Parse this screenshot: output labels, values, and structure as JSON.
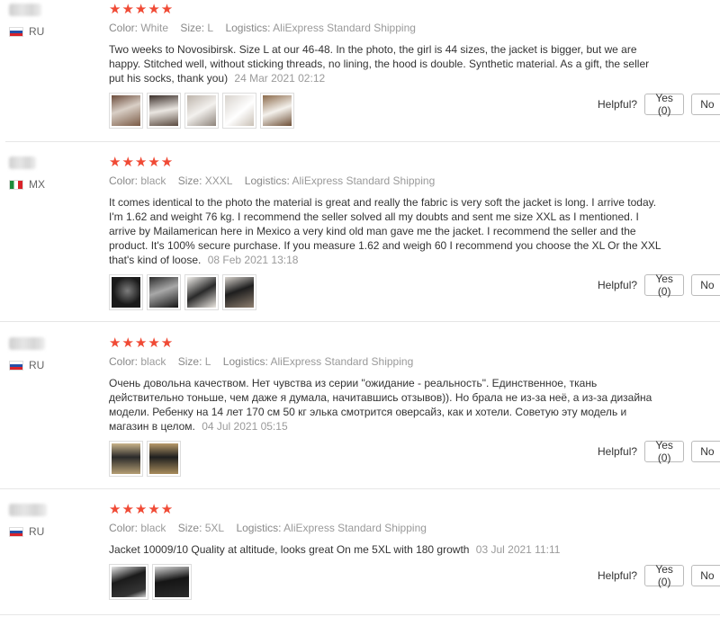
{
  "labels": {
    "color": "Color:",
    "size": "Size:",
    "logistics": "Logistics:",
    "helpful": "Helpful?",
    "stars": "★★★★★",
    "no": "No"
  },
  "colors": {
    "star": "#f04a35",
    "meta": "#9a9a9a",
    "divider": "#e6e6e6"
  },
  "reviews": [
    {
      "country": "RU",
      "flag": "ru",
      "rating": 5,
      "color": "White",
      "size": "L",
      "logistics": "AliExpress Standard Shipping",
      "text": "Two weeks to Novosibirsk. Size L at our 46-48. In the photo, the girl is 44 sizes, the jacket is bigger, but we are happy. Stitched well, without sticking threads, no lining, the hood is double. Synthetic material. As a gift, the seller put his socks, thank you)",
      "date": "24 Mar 2021 02:12",
      "yes": "Yes (0)",
      "photos": [
        "photo",
        "photo",
        "photo",
        "photo",
        "photo"
      ]
    },
    {
      "country": "MX",
      "flag": "mx",
      "rating": 5,
      "color": "black",
      "size": "XXXL",
      "logistics": "AliExpress Standard Shipping",
      "text": "It comes identical to the photo the material is great and really the fabric is very soft the jacket is long. I arrive today. I'm 1.62 and weight 76 kg. I recommend the seller solved all my doubts and sent me size XXL as I mentioned. I arrive by Mailamerican here in Mexico a very kind old man gave me the jacket. I recommend the seller and the product. It's 100% secure purchase. If you measure 1.62 and weigh 60 I recommend you choose the XL Or the XXL that's kind of loose.",
      "date": "08 Feb 2021 13:18",
      "yes": "Yes (0)",
      "photos": [
        "photo",
        "photo",
        "photo",
        "photo"
      ]
    },
    {
      "country": "RU",
      "flag": "ru",
      "rating": 5,
      "color": "black",
      "size": "L",
      "logistics": "AliExpress Standard Shipping",
      "text": "Очень довольна качеством. Нет чувства из серии \"ожидание - реальность\". Единственное, ткань действительно тоньше, чем даже я думала, начитавшись отзывов)). Но брала не из-за неё, а из-за дизайна модели. Ребенку на 14 лет 170 см 50 кг элька смотрится оверсайз, как и хотели. Советую эту модель и магазин в целом.",
      "date": "04 Jul 2021 05:15",
      "yes": "Yes (0)",
      "photos": [
        "photo",
        "photo"
      ]
    },
    {
      "country": "RU",
      "flag": "ru",
      "rating": 5,
      "color": "black",
      "size": "5XL",
      "logistics": "AliExpress Standard Shipping",
      "text": "Jacket 10009/10 Quality at altitude, looks great On me 5XL with 180 growth",
      "date": "03 Jul 2021 11:11",
      "yes": "Yes (0)",
      "photos": [
        "photo",
        "photo"
      ]
    }
  ]
}
